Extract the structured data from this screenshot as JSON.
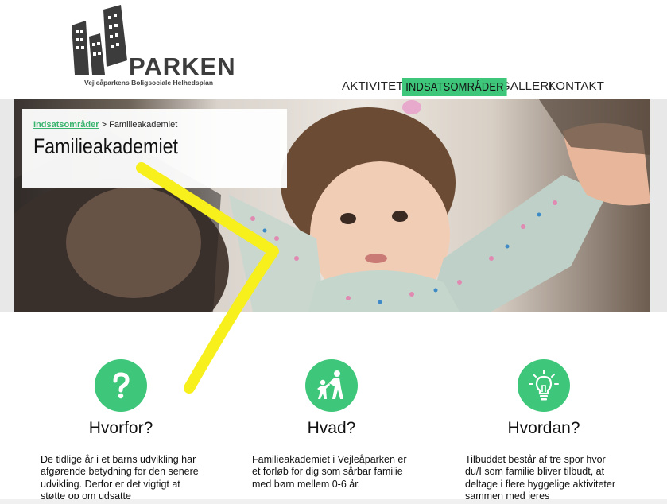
{
  "brand": {
    "name": "PARKEN",
    "tagline": "Vejleåparkens Boligsociale Helhedsplan"
  },
  "nav": {
    "items": [
      {
        "label": "AKTIVITETER"
      },
      {
        "label": "INDSATSOMRÅDER"
      },
      {
        "label": "GALLERI"
      },
      {
        "label": "KONTAKT"
      }
    ],
    "active": "INDSATSOMRÅDER"
  },
  "breadcrumb": {
    "parent": "Indsatsområder",
    "separator": ">",
    "current": "Familieakademiet"
  },
  "page_title": "Familieakademiet",
  "features": [
    {
      "icon": "question-icon",
      "title": "Hvorfor?",
      "text": "De tidlige år i et barns udvikling har afgørende betydning for den senere udvikling. Derfor er det vigtigt at støtte op om udsatte"
    },
    {
      "icon": "family-icon",
      "title": "Hvad?",
      "text": "Familieakademiet i Vejleåparken er et forløb for dig som sårbar familie med børn mellem 0-6 år."
    },
    {
      "icon": "lightbulb-icon",
      "title": "Hvordan?",
      "text": "Tilbuddet består af tre spor hvor du/I som familie bliver tilbudt, at deltage i flere hyggelige aktiviteter sammen med jeres"
    }
  ],
  "colors": {
    "accent": "#3ec77a",
    "link": "#3ab46e",
    "annotation": "#f7f01c"
  }
}
